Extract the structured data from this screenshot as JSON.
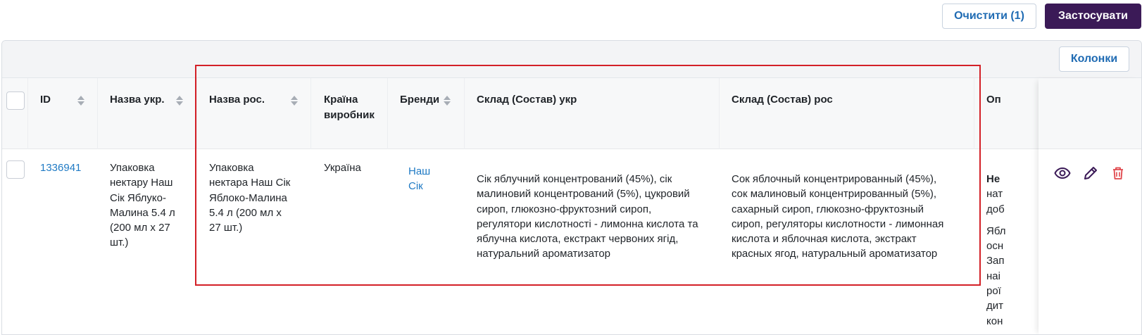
{
  "top_buttons": {
    "clear_label": "Очистити (1)",
    "apply_label": "Застосувати"
  },
  "toolbar": {
    "columns_label": "Колонки"
  },
  "table": {
    "headers": {
      "id": "ID",
      "name_ukr": "Назва укр.",
      "name_rus": "Назва рос.",
      "country_line1": "Країна",
      "country_line2": "виробник",
      "brands": "Бренди",
      "comp_ukr": "Склад (Состав) укр",
      "comp_rus": "Склад (Состав) рос",
      "desc_partial": "Оп"
    },
    "rows": [
      {
        "id": "1336941",
        "name_ukr": [
          "Упаковка",
          "нектару Наш",
          "Сік Яблуко-",
          "Малина 5.4 л",
          "(200 мл х 27",
          "шт.)"
        ],
        "name_rus": [
          "Упаковка",
          "нектара Наш Сік",
          "Яблоко-Малина",
          "5.4 л (200 мл х",
          "27 шт.)"
        ],
        "country": "Україна",
        "brand": [
          "Наш",
          "Сік"
        ],
        "comp_ukr": [
          "Сік яблучний концентрований (45%), сік",
          "малиновий концентрований (5%), цукровий",
          "сироп, глюкозно-фруктозний сироп,",
          "регулятори кислотності - лимонна кислота та",
          "яблучна кислота, екстракт червоних ягід,",
          "натуральний ароматизатор"
        ],
        "comp_rus": [
          "Сок яблочный концентрированный (45%),",
          "сок малиновый концентрированный (5%),",
          "сахарный сироп, глюкозно-фруктозный",
          "сироп, регуляторы кислотности - лимонная",
          "кислота и яблочная кислота, экстракт",
          "красных ягод, натуральный ароматизатор"
        ],
        "desc_partial_a": [
          "Не",
          "нат",
          "доб"
        ],
        "desc_partial_b": [
          "Ябл",
          "осн",
          "Зап",
          "наі",
          "рої",
          "дит",
          "кон"
        ]
      }
    ]
  },
  "colors": {
    "accent": "#3b1a57",
    "link": "#1f7ac4",
    "highlight": "#d32027",
    "delete": "#e0474c",
    "icon": "#3b1a57"
  },
  "icons": {
    "view": "eye-icon",
    "edit": "pencil-icon",
    "delete": "trash-icon"
  }
}
